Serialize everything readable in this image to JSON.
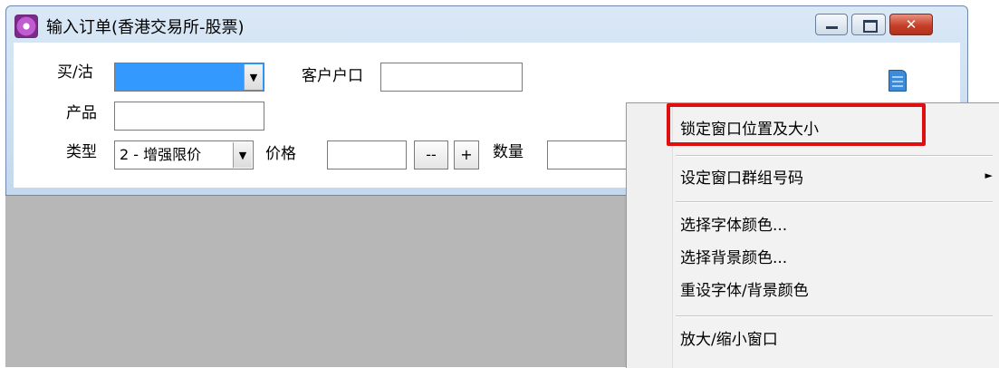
{
  "window": {
    "title": "输入订单(香港交易所-股票)",
    "min_icon": "minimize-icon",
    "max_icon": "maximize-icon",
    "close_icon": "close-icon"
  },
  "form": {
    "buy_sell_label": "买/沽",
    "buy_sell_value": "",
    "account_label": "客户户口",
    "account_value": "",
    "product_label": "产品",
    "product_value": "",
    "type_label": "类型",
    "type_value": "2 - 增强限价",
    "price_label": "价格",
    "price_value": "",
    "price_minus": "--",
    "price_plus": "+",
    "qty_label": "数量",
    "qty_value": ""
  },
  "context_menu": {
    "items": [
      "锁定窗口位置及大小",
      "设定窗口群组号码",
      "选择字体颜色...",
      "选择背景颜色...",
      "重设字体/背景颜色",
      "放大/缩小窗口"
    ],
    "submenu_arrow": "►"
  },
  "colors": {
    "selected_field": "#3399ff",
    "highlight": "#e00f0f"
  }
}
